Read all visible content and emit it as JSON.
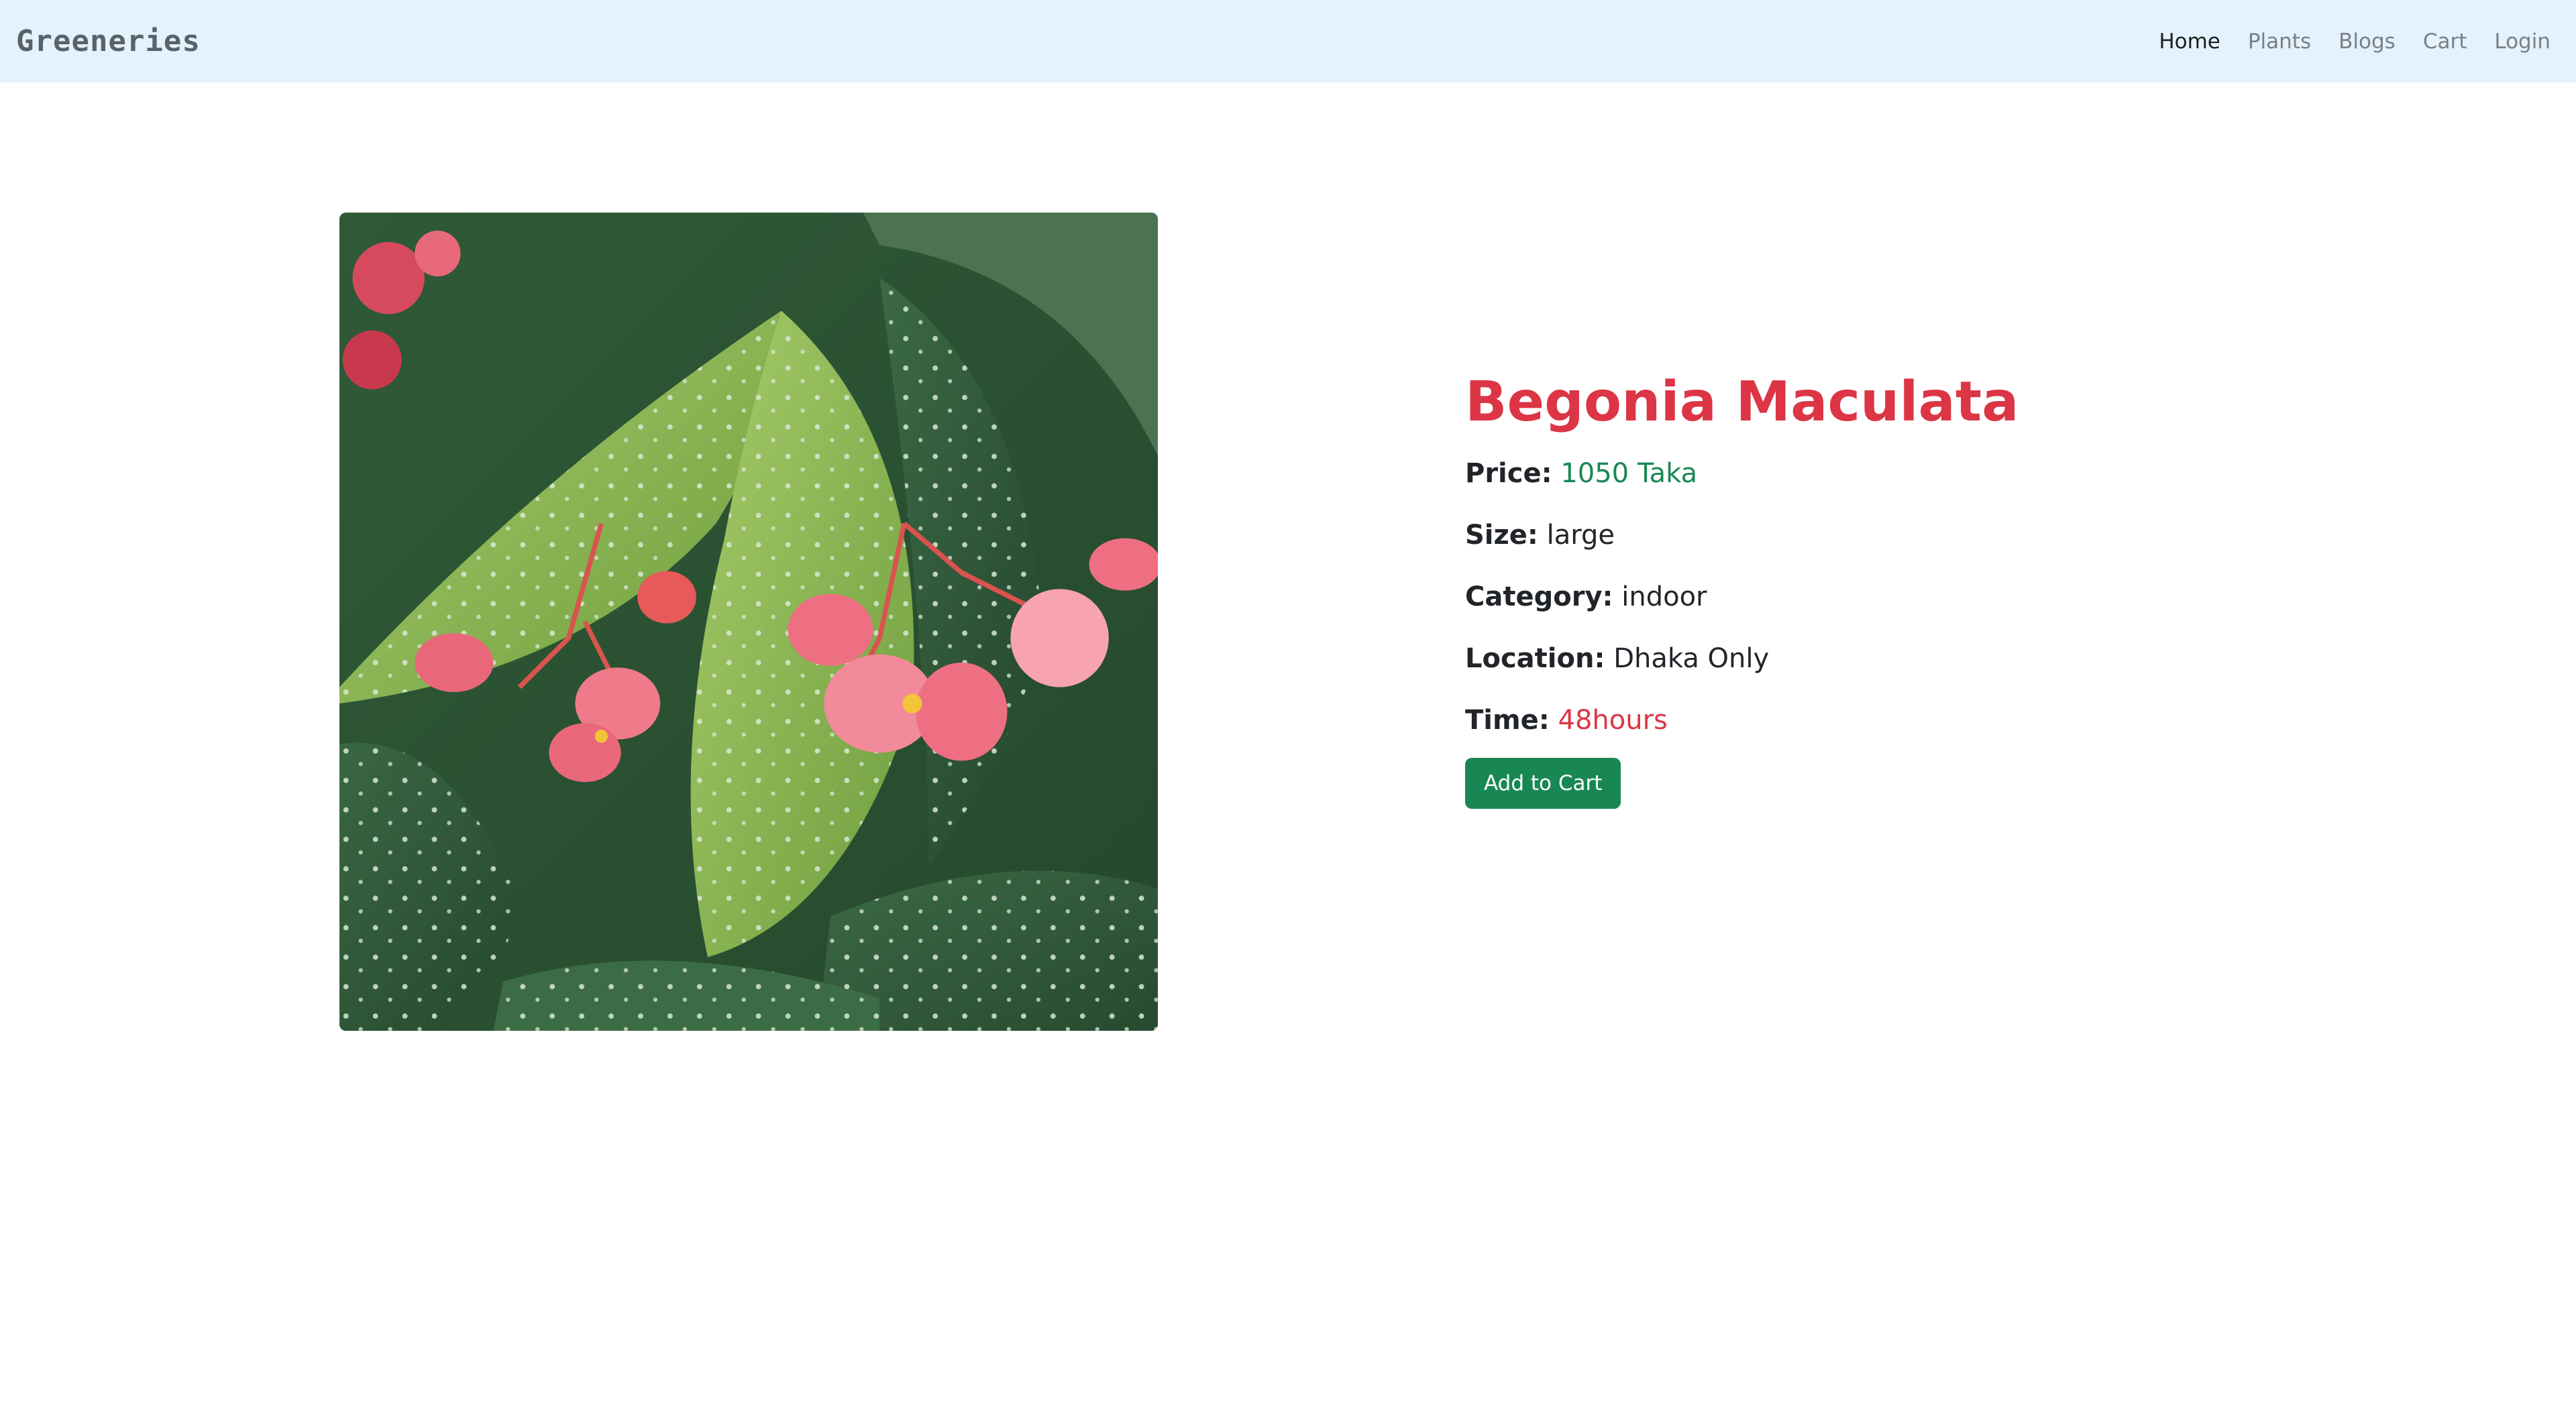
{
  "navbar": {
    "brand": "Greeneries",
    "links": [
      "Home",
      "Plants",
      "Blogs",
      "Cart",
      "Login"
    ],
    "active": "Home",
    "background": "#e3f2fd"
  },
  "product": {
    "name": "Begonia Maculata",
    "image_alt": "Begonia Maculata plant photo",
    "price_label": "Price:",
    "price_value": "1050 Taka",
    "size_label": "Size:",
    "size_value": "large",
    "category_label": "Category:",
    "category_value": "indoor",
    "location_label": "Location:",
    "location_value": "Dhaka Only",
    "time_label": "Time:",
    "time_value": "48hours",
    "add_to_cart_label": "Add to Cart"
  },
  "colors": {
    "title": "#dc3545",
    "price": "#198754",
    "time": "#dc3545",
    "button": "#198754"
  }
}
